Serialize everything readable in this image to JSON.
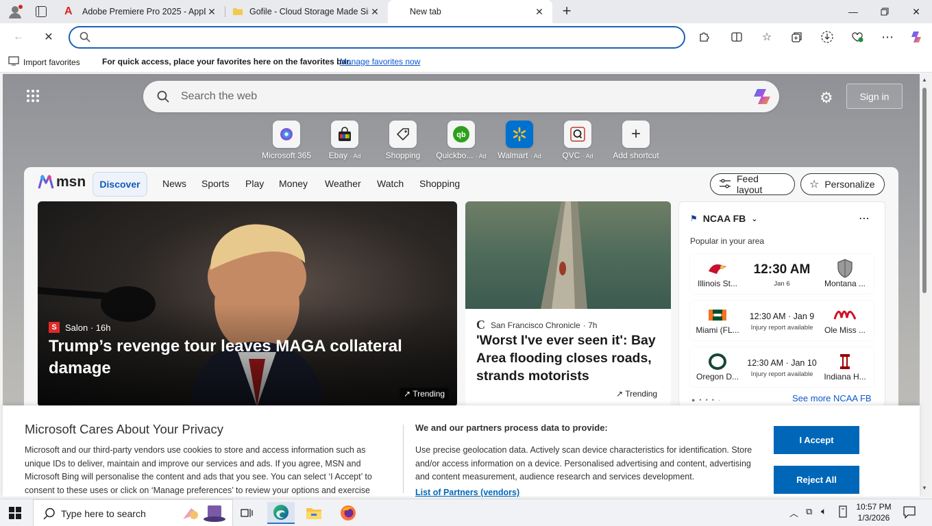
{
  "browser": {
    "tabs": [
      {
        "label": "Adobe Premiere Pro 2025 - AppD",
        "icon": "adobe-icon"
      },
      {
        "label": "Gofile - Cloud Storage Made Sim",
        "icon": "folder-icon"
      },
      {
        "label": "New tab",
        "icon": "",
        "active": true
      }
    ],
    "address_value": "",
    "favorites_bar": {
      "import_label": "Import favorites",
      "hint": "For quick access, place your favorites here on the favorites bar.",
      "manage_link": "Manage favorites now"
    }
  },
  "newtab": {
    "search_placeholder": "Search the web",
    "sign_in": "Sign in",
    "shortcuts": [
      {
        "label": "Microsoft 365",
        "ad": ""
      },
      {
        "label": "Ebay",
        "ad": "· Ad"
      },
      {
        "label": "Shopping",
        "ad": ""
      },
      {
        "label": "Quickbo...",
        "ad": "· Ad"
      },
      {
        "label": "Walmart",
        "ad": "· Ad"
      },
      {
        "label": "QVC",
        "ad": "· Ad"
      },
      {
        "label": "Add shortcut",
        "ad": ""
      }
    ]
  },
  "msn": {
    "logo": "msn",
    "nav": [
      "Discover",
      "News",
      "Sports",
      "Play",
      "Money",
      "Weather",
      "Watch",
      "Shopping"
    ],
    "feed_layout": "Feed layout",
    "personalize": "Personalize",
    "hero": {
      "source": "Salon · 16h",
      "source_badge": "S",
      "headline": "Trump’s revenge tour leaves MAGA collateral damage",
      "trending": "Trending"
    },
    "story2": {
      "source": "San Francisco Chronicle",
      "age": "· 7h",
      "headline": "'Worst I've ever seen it': Bay Area flooding closes roads, strands motorists",
      "trending": "Trending"
    },
    "sports": {
      "league": "NCAA FB",
      "subtitle": "Popular in your area",
      "games": [
        {
          "home": "Illinois St...",
          "time": "12:30 AM",
          "date": "Jan 6",
          "note": "",
          "away": "Montana ..."
        },
        {
          "home": "Miami (FL...",
          "time": "12:30 AM · Jan 9",
          "date": "",
          "note": "Injury report available",
          "away": "Ole Miss ..."
        },
        {
          "home": "Oregon D...",
          "time": "12:30 AM · Jan 10",
          "date": "",
          "note": "Injury report available",
          "away": "Indiana H..."
        }
      ],
      "see_more": "See more NCAA FB"
    }
  },
  "privacy": {
    "title": "Microsoft Cares About Your Privacy",
    "body": "Microsoft and our third-party vendors use cookies to store and access information such as unique IDs to deliver, maintain and improve our services and ads. If you agree, MSN and Microsoft Bing will personalise the content and ads that you see. You can select ‘I Accept’ to consent to these uses or click on ‘Manage preferences’ to review your options and exercise",
    "right_title": "We and our partners process data to provide:",
    "right_body": "Use precise geolocation data. Actively scan device characteristics for identification. Store and/or access information on a device. Personalised advertising and content, advertising and content measurement, audience research and services development.",
    "partners_link": "List of Partners (vendors)",
    "accept": "I Accept",
    "reject": "Reject All"
  },
  "taskbar": {
    "search_placeholder": "Type here to search",
    "time": "10:57 PM",
    "date": "1/3/2026"
  },
  "colors": {
    "accent": "#0067b8",
    "brand_msn_blue": "#1a5fb4"
  }
}
